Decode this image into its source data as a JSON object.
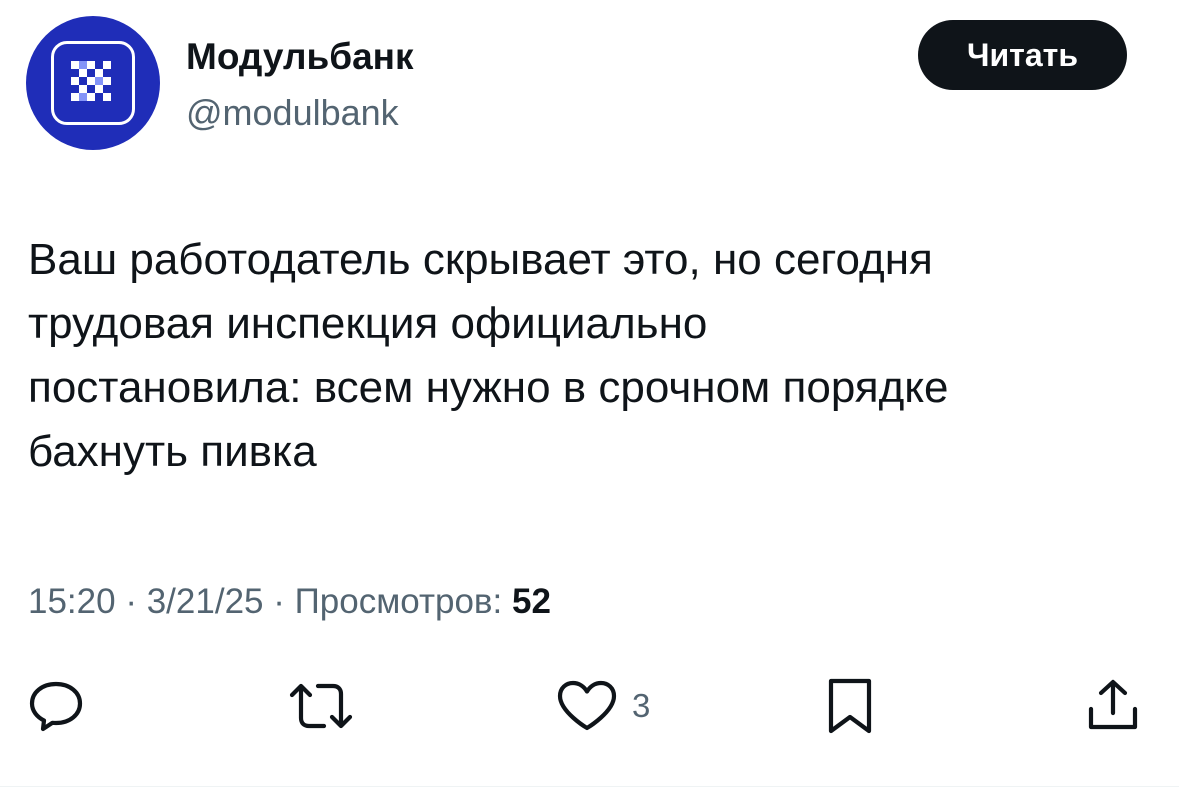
{
  "author": {
    "display_name": "Модульбанк",
    "handle": "@modulbank",
    "avatar_icon": "modulbank-logo-icon",
    "avatar_color": "#1f2db8"
  },
  "header": {
    "read_button_label": "Читать"
  },
  "tweet": {
    "text": "Ваш работодатель скрывает это, но сегодня\nтрудовая инспекция официально\nпостановила: всем нужно в срочном порядке\nбахнуть пивка"
  },
  "meta": {
    "time": "15:20",
    "separator": "·",
    "date": "3/21/25",
    "views_label": "Просмотров:",
    "views_count": "52"
  },
  "actions": {
    "reply_icon": "reply-icon",
    "retweet_icon": "retweet-icon",
    "like_icon": "heart-icon",
    "like_count": "3",
    "bookmark_icon": "bookmark-icon",
    "share_icon": "share-icon"
  },
  "colors": {
    "text_primary": "#0f1419",
    "text_secondary": "#536471",
    "button_bg": "#0f1419"
  }
}
